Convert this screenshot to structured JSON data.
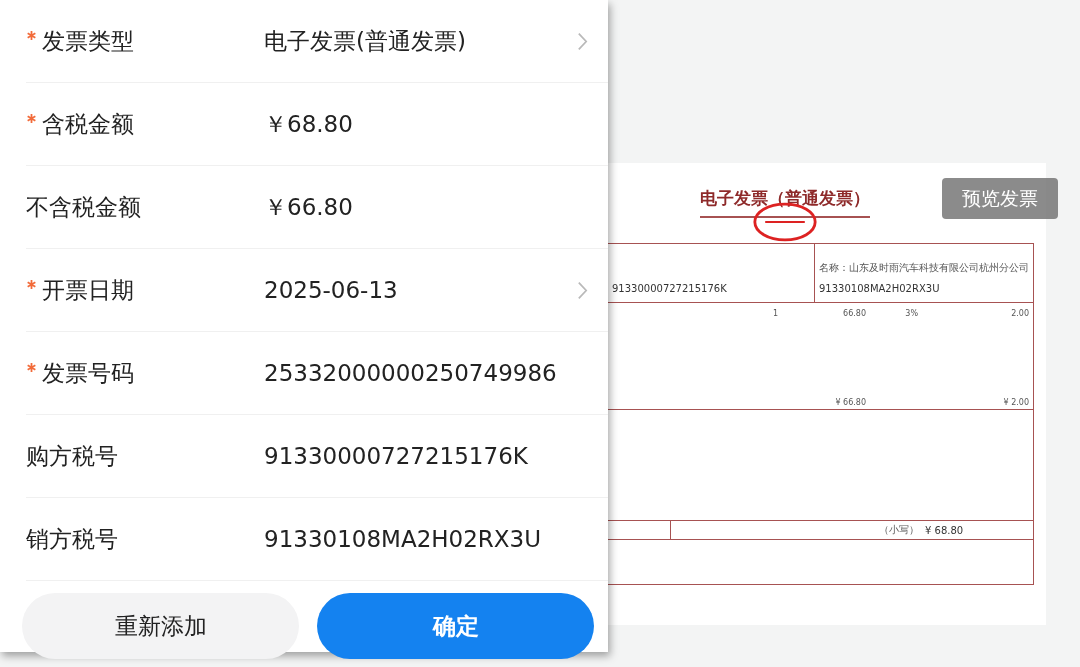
{
  "form": {
    "rows": [
      {
        "label": "发票类型",
        "value": "电子发票(普通发票)",
        "required": true,
        "has_arrow": true
      },
      {
        "label": "含税金额",
        "value": "￥68.80",
        "required": true,
        "has_arrow": false
      },
      {
        "label": "不含税金额",
        "value": "￥66.80",
        "required": false,
        "has_arrow": false
      },
      {
        "label": "开票日期",
        "value": "2025-06-13",
        "required": true,
        "has_arrow": true
      },
      {
        "label": "发票号码",
        "value": "25332000000250749986",
        "required": true,
        "has_arrow": false
      },
      {
        "label": "购方税号",
        "value": "91330000727215176K",
        "required": false,
        "has_arrow": false
      },
      {
        "label": "销方税号",
        "value": "91330108MA2H02RX3U",
        "required": false,
        "has_arrow": false
      }
    ],
    "buttons": [
      {
        "label": "重新添加",
        "kind": "secondary"
      },
      {
        "label": "确定",
        "kind": "primary"
      }
    ]
  },
  "invoice": {
    "title": "电子发票（普通发票）",
    "preview_button": "预览发票",
    "buyer_tax_id": "91330000727215176K",
    "seller_name": "名称：山东及时雨汽车科技有限公司杭州分公司",
    "seller_tax_id": "91330108MA2H02RX3U",
    "item": {
      "quantity": "1",
      "amount": "66.80",
      "tax_rate": "3%",
      "tax": "2.00"
    },
    "subtotal_amount": "¥ 66.80",
    "subtotal_tax": "¥ 2.00",
    "total_label": "（小写）",
    "total": "¥ 68.80"
  }
}
